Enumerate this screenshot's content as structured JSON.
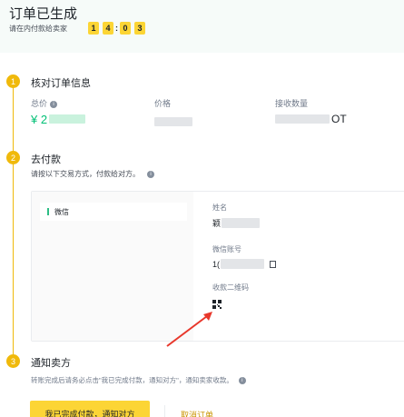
{
  "header": {
    "title": "订单已生成",
    "pay_hint": "请在内付款给卖家",
    "timer": [
      "1",
      "4",
      "0",
      "3"
    ],
    "timer_separator": ":"
  },
  "steps": [
    {
      "num": "1",
      "title": "核对订单信息"
    },
    {
      "num": "2",
      "title": "去付款"
    },
    {
      "num": "3",
      "title": "通知卖方"
    }
  ],
  "order_info": {
    "total_label": "总价",
    "total_value": "¥ 2",
    "price_label": "价格",
    "quantity_label": "接收数量",
    "quantity_suffix": "OT"
  },
  "payment": {
    "description": "请按以下交易方式，付款给对方。",
    "method": "微信",
    "name_label": "姓名",
    "name_value_prefix": "颖",
    "account_label": "微信账号",
    "account_value_prefix": "1(",
    "qr_label": "收款二维码"
  },
  "notify": {
    "description": "转账完成后请务必点击\"我已完成付款，通知对方\"，通知卖家收款。",
    "confirm_button": "我已完成付款，通知对方",
    "cancel_link": "取消订单"
  },
  "colors": {
    "accent": "#f0b90b",
    "button": "#fcd535",
    "green": "#02c076",
    "link": "#c99400"
  }
}
